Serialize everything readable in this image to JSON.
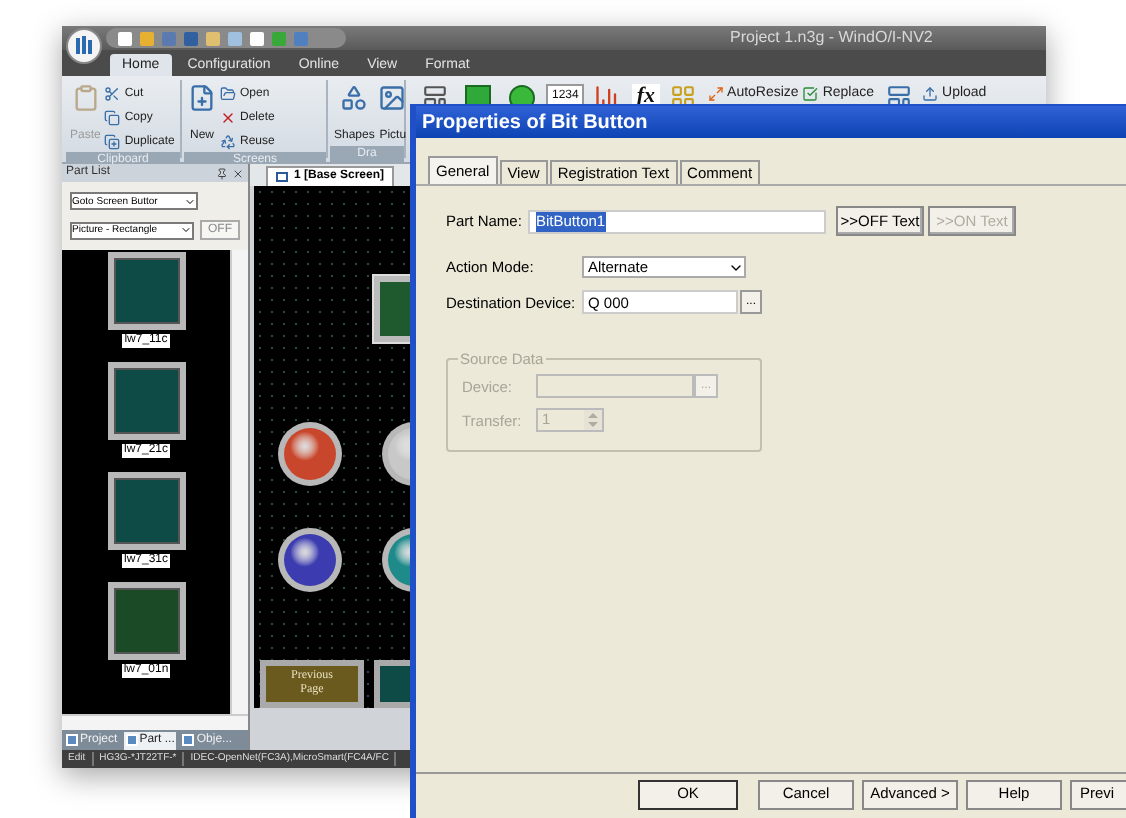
{
  "app": {
    "title": "Project 1.n3g - WindO/I-NV2",
    "ribbon_tabs": [
      {
        "label": "Home",
        "selected": true
      },
      {
        "label": "Configuration",
        "selected": false
      },
      {
        "label": "Online",
        "selected": false
      },
      {
        "label": "View",
        "selected": false
      },
      {
        "label": "Format",
        "selected": false
      }
    ],
    "ribbon_groups": [
      {
        "label": "Clipboard",
        "items": [
          {
            "label": "Paste",
            "kind": "large",
            "disabled": true
          },
          {
            "label": "Cut",
            "kind": "small",
            "disabled": false
          },
          {
            "label": "Copy",
            "kind": "small",
            "disabled": false
          },
          {
            "label": "Duplicate",
            "kind": "small",
            "disabled": false
          }
        ]
      },
      {
        "label": "Screens",
        "items": [
          {
            "label": "New",
            "kind": "large",
            "disabled": false
          },
          {
            "label": "Open",
            "kind": "small",
            "disabled": false
          },
          {
            "label": "Delete",
            "kind": "small",
            "disabled": false
          },
          {
            "label": "Reuse",
            "kind": "small",
            "disabled": false
          }
        ]
      },
      {
        "label": "Dra",
        "items": [
          {
            "label": "Shapes",
            "kind": "large",
            "disabled": false
          },
          {
            "label": "Pictu",
            "kind": "large",
            "disabled": false
          }
        ]
      }
    ],
    "ribbon_tools": [
      {
        "kind": "icon"
      },
      {
        "kind": "icon"
      },
      {
        "kind": "icon"
      },
      {
        "kind": "glyph",
        "label": "1234"
      },
      {
        "kind": "icon"
      },
      {
        "kind": "glyph",
        "label": "fx"
      },
      {
        "kind": "icon"
      },
      {
        "kind": "button",
        "label": "AutoResize"
      },
      {
        "kind": "button",
        "label": "Replace"
      },
      {
        "kind": "icon"
      },
      {
        "kind": "button",
        "label": "Upload"
      }
    ],
    "part_list": {
      "title": "Part List",
      "filter": "Goto Screen Buttor",
      "type": "Picture - Rectangle",
      "toggle": "OFF",
      "items": [
        {
          "label": "lw7_11c",
          "color": "#0e4a46"
        },
        {
          "label": "lw7_21c",
          "color": "#0e4a46"
        },
        {
          "label": "lw7_31c",
          "color": "#0e4a46"
        },
        {
          "label": "lw7_01n",
          "color": "#1b4a26"
        }
      ],
      "tabs": [
        {
          "label": "Project",
          "selected": false
        },
        {
          "label": "Part ...",
          "selected": true
        },
        {
          "label": "Obje...",
          "selected": false
        }
      ]
    },
    "editor": {
      "tab": "1 [Base Screen]",
      "lamps": [
        {
          "color": "#c8472c"
        },
        {
          "color": "#c8c8c8"
        },
        {
          "color": "#3c3cb0"
        },
        {
          "color": "#1f8a8a"
        }
      ],
      "page_button": "Previous Page"
    },
    "status_bar": [
      "Edit",
      "HG3G-*JT22TF-*",
      "IDEC-OpenNet(FC3A),MicroSmart(FC4A/FC"
    ]
  },
  "dialog": {
    "title": "Properties of Bit Button",
    "tabs": [
      {
        "label": "General",
        "selected": true
      },
      {
        "label": "View",
        "selected": false
      },
      {
        "label": "Registration Text",
        "selected": false
      },
      {
        "label": "Comment",
        "selected": false
      }
    ],
    "part_name": {
      "label": "Part Name:",
      "value": "BitButton1",
      "highlighted": true
    },
    "text_buttons": [
      {
        "label": ">>OFF Text",
        "disabled": false
      },
      {
        "label": ">>ON Text",
        "disabled": true
      }
    ],
    "action_mode": {
      "label": "Action Mode:",
      "value": "Alternate"
    },
    "destination": {
      "label": "Destination Device:",
      "value": "Q 000",
      "browse": "..."
    },
    "source_data": {
      "title": "Source Data",
      "disabled": true,
      "device": {
        "label": "Device:",
        "browse": "..."
      },
      "transfer": {
        "label": "Transfer:",
        "value": "1"
      }
    },
    "buttons": [
      "OK",
      "Cancel",
      "Advanced >",
      "Help",
      "Previ"
    ]
  }
}
